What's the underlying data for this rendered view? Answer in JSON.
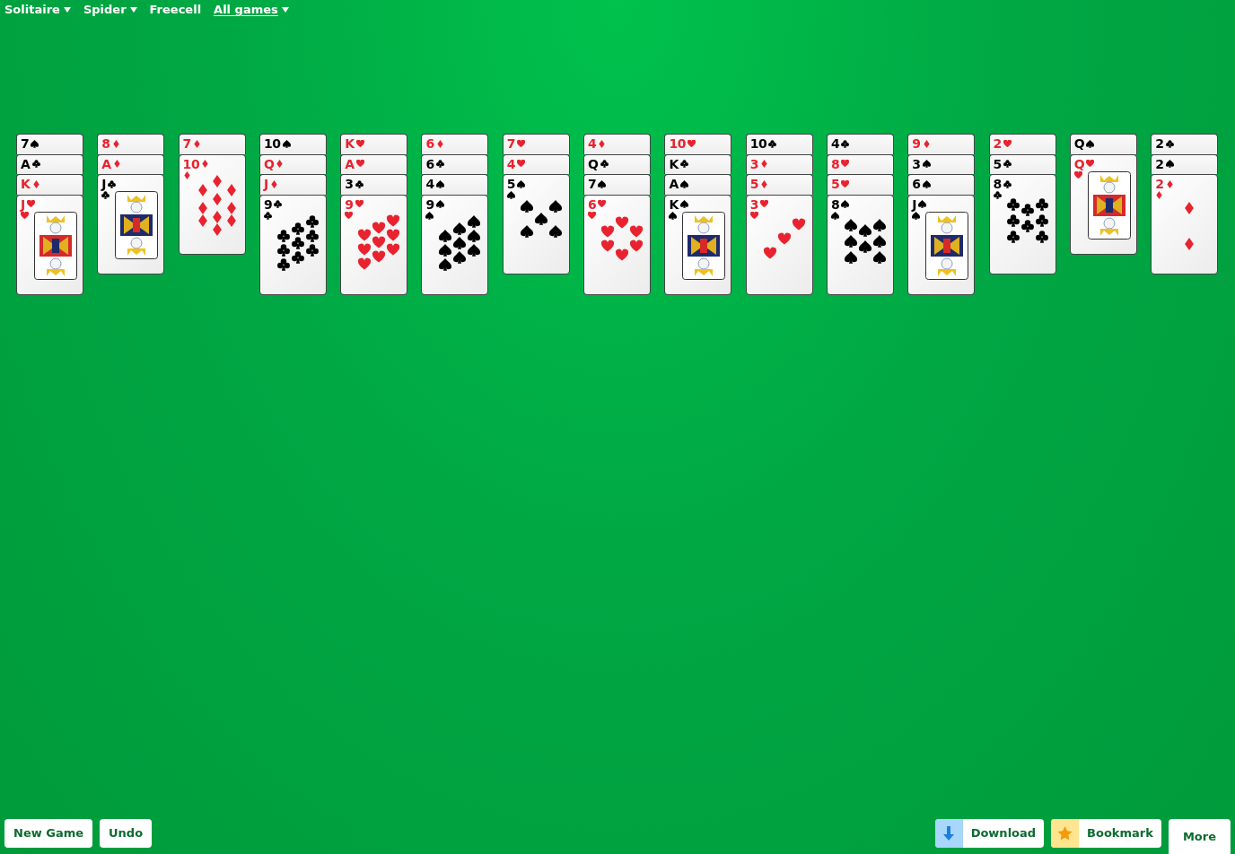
{
  "nav": [
    {
      "label": "Solitaire",
      "dropdown": true,
      "selected": false
    },
    {
      "label": "Spider",
      "dropdown": true,
      "selected": false
    },
    {
      "label": "Freecell",
      "dropdown": false,
      "selected": false
    },
    {
      "label": "All games",
      "dropdown": true,
      "selected": true
    }
  ],
  "tableau": [
    {
      "covered": [
        {
          "rank": "7",
          "kind": "spades"
        },
        {
          "rank": "A",
          "kind": "clubs"
        },
        {
          "rank": "K",
          "kind": "diamonds"
        }
      ],
      "top": {
        "rank": "J",
        "kind": "hearts",
        "court": true
      }
    },
    {
      "covered": [
        {
          "rank": "8",
          "kind": "diamonds"
        },
        {
          "rank": "A",
          "kind": "diamonds"
        }
      ],
      "top": {
        "rank": "J",
        "kind": "clubs",
        "court": true
      }
    },
    {
      "covered": [
        {
          "rank": "7",
          "kind": "diamonds"
        }
      ],
      "top": {
        "rank": "10",
        "kind": "diamonds",
        "court": false
      }
    },
    {
      "covered": [
        {
          "rank": "10",
          "kind": "spades"
        },
        {
          "rank": "Q",
          "kind": "diamonds"
        },
        {
          "rank": "J",
          "kind": "diamonds"
        }
      ],
      "top": {
        "rank": "9",
        "kind": "clubs",
        "court": false
      }
    },
    {
      "covered": [
        {
          "rank": "K",
          "kind": "hearts"
        },
        {
          "rank": "A",
          "kind": "hearts"
        },
        {
          "rank": "3",
          "kind": "clubs"
        }
      ],
      "top": {
        "rank": "9",
        "kind": "hearts",
        "court": false
      }
    },
    {
      "covered": [
        {
          "rank": "6",
          "kind": "diamonds"
        },
        {
          "rank": "6",
          "kind": "clubs"
        },
        {
          "rank": "4",
          "kind": "spades"
        }
      ],
      "top": {
        "rank": "9",
        "kind": "spades",
        "court": false
      }
    },
    {
      "covered": [
        {
          "rank": "7",
          "kind": "hearts"
        },
        {
          "rank": "4",
          "kind": "hearts"
        }
      ],
      "top": {
        "rank": "5",
        "kind": "spades",
        "court": false
      }
    },
    {
      "covered": [
        {
          "rank": "4",
          "kind": "diamonds"
        },
        {
          "rank": "Q",
          "kind": "clubs"
        },
        {
          "rank": "7",
          "kind": "spades"
        }
      ],
      "top": {
        "rank": "6",
        "kind": "hearts",
        "court": false
      }
    },
    {
      "covered": [
        {
          "rank": "10",
          "kind": "hearts"
        },
        {
          "rank": "K",
          "kind": "clubs"
        },
        {
          "rank": "A",
          "kind": "spades"
        }
      ],
      "top": {
        "rank": "K",
        "kind": "spades",
        "court": true
      }
    },
    {
      "covered": [
        {
          "rank": "10",
          "kind": "clubs"
        },
        {
          "rank": "3",
          "kind": "diamonds"
        },
        {
          "rank": "5",
          "kind": "diamonds"
        }
      ],
      "top": {
        "rank": "3",
        "kind": "hearts",
        "court": false
      }
    },
    {
      "covered": [
        {
          "rank": "4",
          "kind": "clubs"
        },
        {
          "rank": "8",
          "kind": "hearts"
        },
        {
          "rank": "5",
          "kind": "hearts"
        }
      ],
      "top": {
        "rank": "8",
        "kind": "spades",
        "court": false
      }
    },
    {
      "covered": [
        {
          "rank": "9",
          "kind": "diamonds"
        },
        {
          "rank": "3",
          "kind": "spades"
        },
        {
          "rank": "6",
          "kind": "spades"
        }
      ],
      "top": {
        "rank": "J",
        "kind": "spades",
        "court": true
      }
    },
    {
      "covered": [
        {
          "rank": "2",
          "kind": "hearts"
        },
        {
          "rank": "5",
          "kind": "clubs"
        }
      ],
      "top": {
        "rank": "8",
        "kind": "clubs",
        "court": false
      }
    },
    {
      "covered": [
        {
          "rank": "Q",
          "kind": "spades"
        }
      ],
      "top": {
        "rank": "Q",
        "kind": "hearts",
        "court": true
      }
    },
    {
      "covered": [
        {
          "rank": "2",
          "kind": "clubs"
        },
        {
          "rank": "2",
          "kind": "spades"
        }
      ],
      "top": {
        "rank": "2",
        "kind": "diamonds",
        "court": false
      }
    }
  ],
  "toolbar_left": [
    {
      "label": "New Game"
    },
    {
      "label": "Undo"
    }
  ],
  "toolbar_right": [
    {
      "label": "Download",
      "kind": "download"
    },
    {
      "label": "Bookmark",
      "kind": "bookmark"
    },
    {
      "label": "More",
      "kind": "plain"
    }
  ]
}
